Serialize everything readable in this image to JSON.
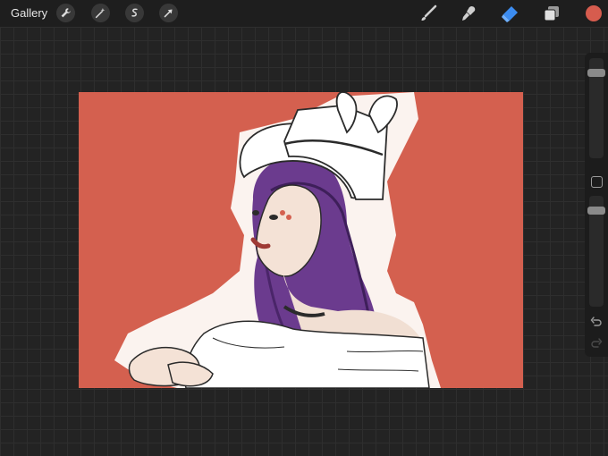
{
  "topbar": {
    "gallery_label": "Gallery",
    "left_tools": [
      "wrench-icon",
      "magic-wand-icon",
      "selection-icon",
      "transform-arrow-icon"
    ],
    "right_tools": [
      "brush-icon",
      "smudge-icon",
      "eraser-icon",
      "layers-icon"
    ],
    "active_tool": "eraser",
    "current_color": "#d65c4e"
  },
  "sidebar": {
    "brush_size_level": 0.12,
    "opacity_level": 0.35
  },
  "canvas": {
    "background_color": "#d4604f",
    "subject": "sketch-of-girl-with-purple-hair-and-bunny-ear-hat"
  },
  "colors": {
    "accent_blue": "#3c8cf0",
    "ui_gray": "#cfcfcf"
  }
}
